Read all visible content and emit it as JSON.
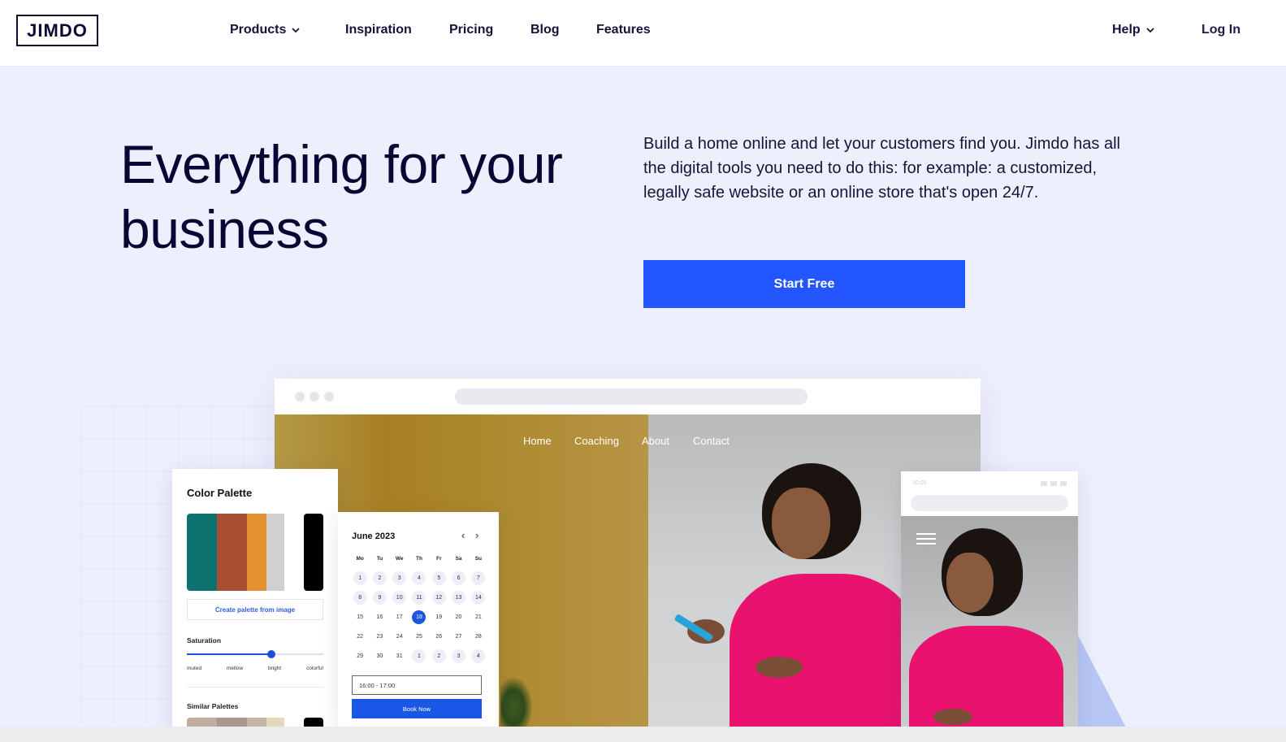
{
  "header": {
    "logo": "JIMDO",
    "nav": [
      {
        "label": "Products",
        "has_dropdown": true
      },
      {
        "label": "Inspiration",
        "has_dropdown": false
      },
      {
        "label": "Pricing",
        "has_dropdown": false
      },
      {
        "label": "Blog",
        "has_dropdown": false
      },
      {
        "label": "Features",
        "has_dropdown": false
      }
    ],
    "help": {
      "label": "Help",
      "has_dropdown": true
    },
    "login": "Log In"
  },
  "hero": {
    "title": "Everything for your business",
    "description": "Build a home online and let your customers find you. Jimdo has all the digital tools you need to do this: for example: a customized, legally safe website or an online store that's open 24/7.",
    "cta": "Start Free"
  },
  "mockup": {
    "site_nav": [
      "Home",
      "Coaching",
      "About",
      "Contact"
    ],
    "color_palette": {
      "title": "Color Palette",
      "swatches": [
        "#0e7370",
        "#a84e32",
        "#e3902e",
        "#d0d0d0",
        "#000000"
      ],
      "create_button": "Create palette from image",
      "saturation_label": "Saturation",
      "saturation_levels": [
        "muted",
        "mellow",
        "bright",
        "colorful"
      ],
      "saturation_value": 0.62,
      "similar_title": "Similar Palettes",
      "similar_swatches": [
        "#c3ada0",
        "#a89890",
        "#c8b4a4",
        "#e3d9bd",
        "#000000"
      ]
    },
    "calendar": {
      "month": "June 2023",
      "prev_icon": "chevron-left-icon",
      "next_icon": "chevron-right-icon",
      "weekdays": [
        "Mo",
        "Tu",
        "We",
        "Th",
        "Fr",
        "Sa",
        "Su"
      ],
      "days": [
        {
          "d": "1",
          "s": "avail"
        },
        {
          "d": "2",
          "s": "avail"
        },
        {
          "d": "3",
          "s": "avail"
        },
        {
          "d": "4",
          "s": "avail"
        },
        {
          "d": "5",
          "s": "avail"
        },
        {
          "d": "6",
          "s": "avail"
        },
        {
          "d": "7",
          "s": "avail"
        },
        {
          "d": "8",
          "s": "avail"
        },
        {
          "d": "9",
          "s": "avail"
        },
        {
          "d": "10",
          "s": "avail"
        },
        {
          "d": "11",
          "s": "avail"
        },
        {
          "d": "12",
          "s": "avail"
        },
        {
          "d": "13",
          "s": "avail"
        },
        {
          "d": "14",
          "s": "avail"
        },
        {
          "d": "15",
          "s": ""
        },
        {
          "d": "16",
          "s": ""
        },
        {
          "d": "17",
          "s": ""
        },
        {
          "d": "18",
          "s": "sel"
        },
        {
          "d": "19",
          "s": ""
        },
        {
          "d": "20",
          "s": ""
        },
        {
          "d": "21",
          "s": ""
        },
        {
          "d": "22",
          "s": ""
        },
        {
          "d": "23",
          "s": ""
        },
        {
          "d": "24",
          "s": ""
        },
        {
          "d": "25",
          "s": ""
        },
        {
          "d": "26",
          "s": ""
        },
        {
          "d": "27",
          "s": ""
        },
        {
          "d": "28",
          "s": ""
        },
        {
          "d": "29",
          "s": ""
        },
        {
          "d": "30",
          "s": ""
        },
        {
          "d": "31",
          "s": ""
        },
        {
          "d": "1",
          "s": "avail"
        },
        {
          "d": "2",
          "s": "avail"
        },
        {
          "d": "3",
          "s": "avail"
        },
        {
          "d": "4",
          "s": "avail"
        }
      ],
      "time_slot": "16:00 - 17:00",
      "book_button": "Book Now"
    },
    "mobile": {
      "time": "10:05"
    }
  },
  "colors": {
    "brand_dark": "#0b0a33",
    "accent_blue": "#2356ff",
    "hero_bg": "#edeffd"
  }
}
